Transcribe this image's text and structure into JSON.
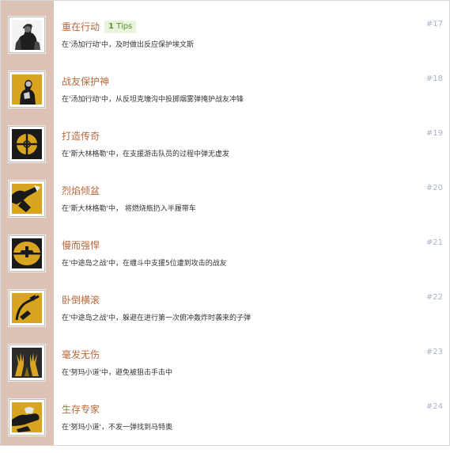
{
  "achievements": [
    {
      "number": "#17",
      "title": "重在行动",
      "tips_count": "1",
      "tips_label": "Tips",
      "description": "在'汤加行动'中，及时做出反应保护埃文斯",
      "icon": "soldiers-portrait-icon"
    },
    {
      "number": "#18",
      "title": "战友保护神",
      "tips_count": "",
      "tips_label": "",
      "description": "在'汤加行动'中，从反坦克壕沟中投掷烟雾弹掩护战友冲锋",
      "icon": "soldier-shield-icon"
    },
    {
      "number": "#19",
      "title": "打造传奇",
      "tips_count": "",
      "tips_label": "",
      "description": "在'斯大林格勒'中，在支援游击队员的过程中弹无虚发",
      "icon": "crosshair-icon"
    },
    {
      "number": "#20",
      "title": "烈焰倾盆",
      "tips_count": "",
      "tips_label": "",
      "description": "在'斯大林格勒'中， 将燃烧瓶扔入半履带车",
      "icon": "firebomb-throw-icon"
    },
    {
      "number": "#21",
      "title": "慢而强悍",
      "tips_count": "",
      "tips_label": "",
      "description": "在'中途岛之战'中，在缠斗中支援5位遭到攻击的战友",
      "icon": "plane-scope-icon"
    },
    {
      "number": "#22",
      "title": "卧倒横滚",
      "tips_count": "",
      "tips_label": "",
      "description": "在'中途岛之战'中，躲避在进行第一次俯冲轰炸时袭来的子弹",
      "icon": "dodging-bullet-icon"
    },
    {
      "number": "#23",
      "title": "毫发无伤",
      "tips_count": "",
      "tips_label": "",
      "description": "在'努玛小道'中，避免被狙击手击中",
      "icon": "claw-hands-icon"
    },
    {
      "number": "#24",
      "title": "生存专家",
      "tips_count": "",
      "tips_label": "",
      "description": "在'努玛小道'，不发一弹找到马特奥",
      "icon": "survival-hands-icon"
    }
  ]
}
